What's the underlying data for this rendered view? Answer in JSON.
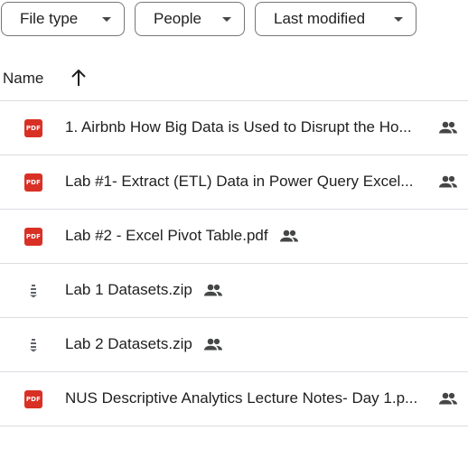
{
  "filters": {
    "file_type": "File type",
    "people": "People",
    "last_modified": "Last modified"
  },
  "list_header": {
    "name": "Name",
    "sort_icon": "arrow-up-icon"
  },
  "files": [
    {
      "name": "1. Airbnb  How Big Data is Used to Disrupt the Ho...",
      "type": "pdf",
      "shared": true
    },
    {
      "name": "Lab #1-  Extract (ETL) Data in Power Query Excel...",
      "type": "pdf",
      "shared": true
    },
    {
      "name": "Lab #2 - Excel Pivot Table.pdf",
      "type": "pdf",
      "shared": true
    },
    {
      "name": "Lab 1 Datasets.zip",
      "type": "zip",
      "shared": true
    },
    {
      "name": "Lab 2 Datasets.zip",
      "type": "zip",
      "shared": true
    },
    {
      "name": "NUS Descriptive Analytics Lecture Notes- Day 1.p...",
      "type": "pdf",
      "shared": true
    }
  ],
  "icons": {
    "pdf_badge_text": "PDF",
    "pdf_color": "#d93025",
    "zip_color": "#5f6368",
    "shared_icon": "people-icon"
  }
}
